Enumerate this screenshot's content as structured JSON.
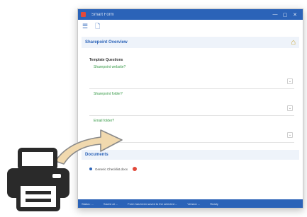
{
  "window": {
    "title": "Smart Form",
    "controls": [
      "—",
      "▢",
      "✕"
    ]
  },
  "toolbar": {
    "menu_icon": "menu-icon",
    "doc_icon": "document-icon"
  },
  "overview": {
    "title": "Sharepoint Overview",
    "icon": "home-icon"
  },
  "group": {
    "title": "Template Questions"
  },
  "questions": [
    {
      "label": "Sharepoint website?"
    },
    {
      "label": "Sharepoint folder?"
    },
    {
      "label": "Email folder?"
    }
  ],
  "documents": {
    "title": "Documents",
    "items": [
      {
        "label": "Generic Checklist.docx"
      }
    ]
  },
  "status": {
    "items": [
      "Status: ...",
      "Saved at ...",
      "Form has been saved to the selected ...",
      "Version ...",
      "Ready"
    ]
  },
  "colors": {
    "accent": "#2b63b8",
    "question_label": "#3a9b4a",
    "status_dot": "#e2493a"
  }
}
